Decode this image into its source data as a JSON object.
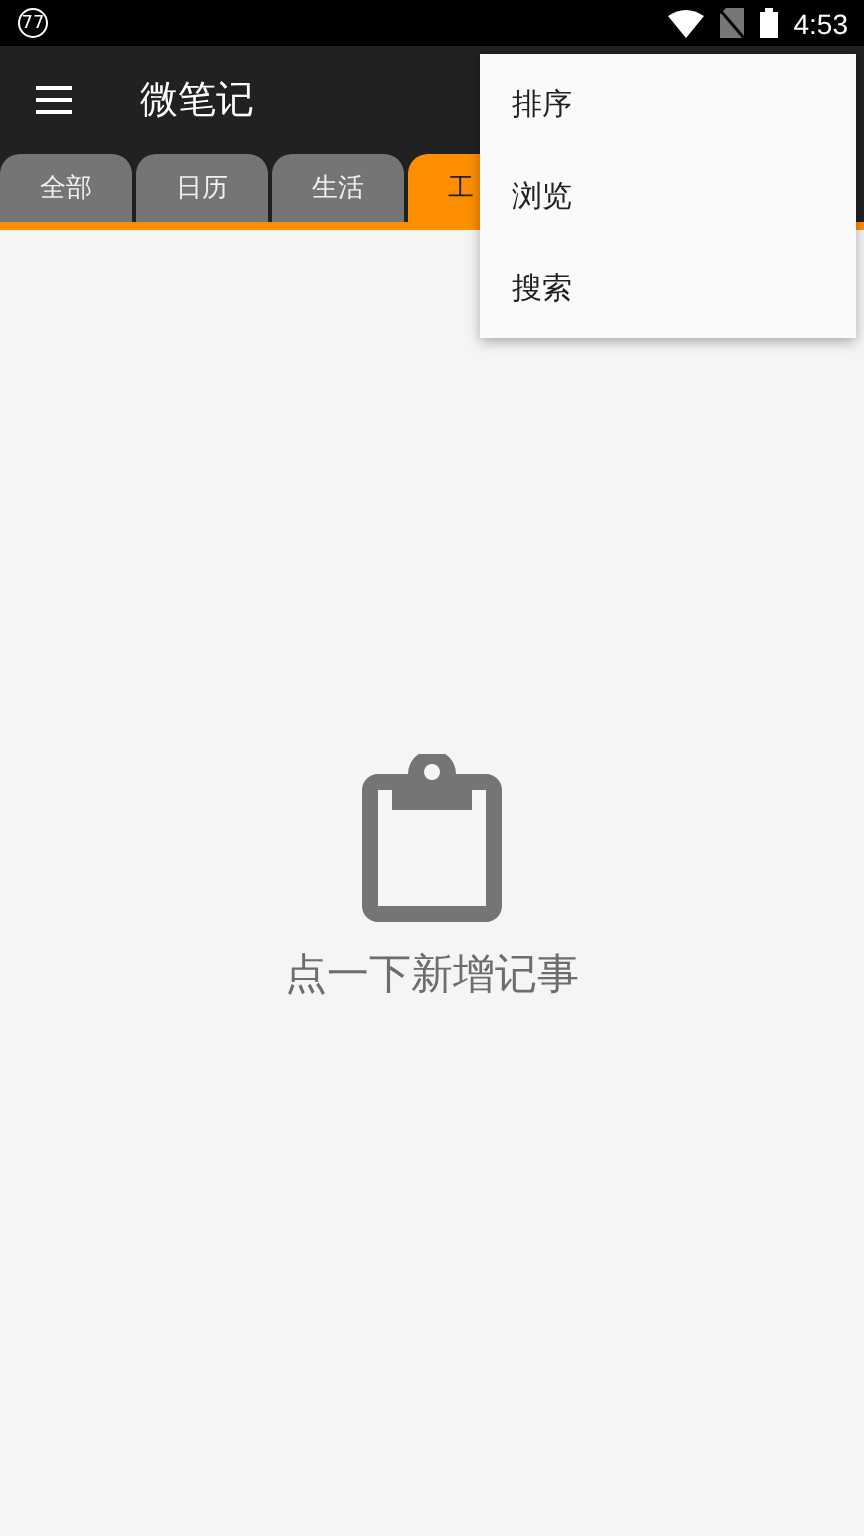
{
  "status_bar": {
    "notification_badge": "77",
    "time": "4:53"
  },
  "app_bar": {
    "title": "微笔记"
  },
  "tabs": [
    {
      "label": "全部",
      "selected": false
    },
    {
      "label": "日历",
      "selected": false
    },
    {
      "label": "生活",
      "selected": false
    },
    {
      "label": "工",
      "selected": true
    }
  ],
  "menu": {
    "items": [
      "排序",
      "浏览",
      "搜索"
    ]
  },
  "empty_state": {
    "message": "点一下新增记事"
  }
}
